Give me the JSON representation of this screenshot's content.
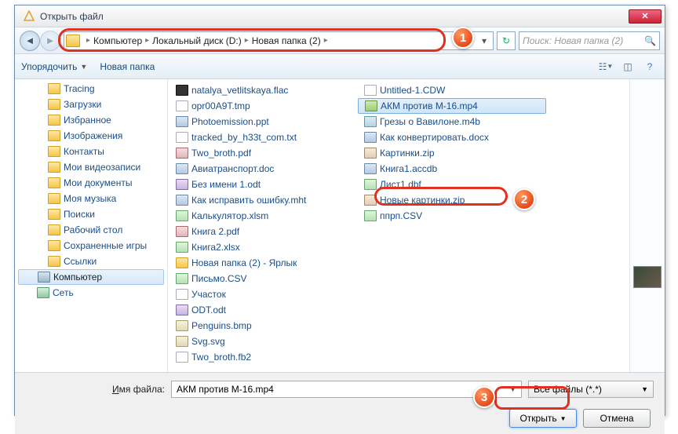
{
  "title": "Открыть файл",
  "breadcrumb": [
    "Компьютер",
    "Локальный диск (D:)",
    "Новая папка (2)"
  ],
  "search_placeholder": "Поиск: Новая папка (2)",
  "toolbar": {
    "organize": "Упорядочить",
    "newfolder": "Новая папка"
  },
  "tree": [
    {
      "label": "Tracing",
      "ico": "folder",
      "lvl": 1
    },
    {
      "label": "Загрузки",
      "ico": "folder",
      "lvl": 1
    },
    {
      "label": "Избранное",
      "ico": "folder",
      "lvl": 1
    },
    {
      "label": "Изображения",
      "ico": "folder",
      "lvl": 1
    },
    {
      "label": "Контакты",
      "ico": "folder",
      "lvl": 1
    },
    {
      "label": "Мои видеозаписи",
      "ico": "folder",
      "lvl": 1
    },
    {
      "label": "Мои документы",
      "ico": "folder",
      "lvl": 1
    },
    {
      "label": "Моя музыка",
      "ico": "folder",
      "lvl": 1
    },
    {
      "label": "Поиски",
      "ico": "folder",
      "lvl": 1
    },
    {
      "label": "Рабочий стол",
      "ico": "folder",
      "lvl": 1
    },
    {
      "label": "Сохраненные игры",
      "ico": "folder",
      "lvl": 1
    },
    {
      "label": "Ссылки",
      "ico": "folder",
      "lvl": 1
    },
    {
      "label": "Компьютер",
      "ico": "comp",
      "lvl": 0,
      "sel": true
    },
    {
      "label": "Сеть",
      "ico": "net",
      "lvl": 0
    }
  ],
  "files_col1": [
    {
      "name": "natalya_vetlitskaya.flac",
      "ico": "flac"
    },
    {
      "name": "opr00A9T.tmp",
      "ico": "txt"
    },
    {
      "name": "Photoemission.ppt",
      "ico": "doc"
    },
    {
      "name": "tracked_by_h33t_com.txt",
      "ico": "txt"
    },
    {
      "name": "Two_broth.pdf",
      "ico": "pdf"
    },
    {
      "name": "Авиатранспорт.doc",
      "ico": "doc"
    },
    {
      "name": "Без имени 1.odt",
      "ico": "odt"
    },
    {
      "name": "Как исправить ошибку.mht",
      "ico": "doc"
    },
    {
      "name": "Калькулятор.xlsm",
      "ico": "xls"
    },
    {
      "name": "Книга 2.pdf",
      "ico": "pdf"
    },
    {
      "name": "Книга2.xlsx",
      "ico": "xls"
    },
    {
      "name": "Новая папка (2) - Ярлык",
      "ico": "folder"
    },
    {
      "name": "Письмо.CSV",
      "ico": "xls"
    },
    {
      "name": "Участок",
      "ico": "txt"
    }
  ],
  "files_col2": [
    {
      "name": "ODT.odt",
      "ico": "odt"
    },
    {
      "name": "Penguins.bmp",
      "ico": "img"
    },
    {
      "name": "Svg.svg",
      "ico": "img"
    },
    {
      "name": "Two_broth.fb2",
      "ico": "txt"
    },
    {
      "name": "Untitled-1.CDW",
      "ico": "txt"
    },
    {
      "name": "АКМ против М-16.mp4",
      "ico": "mp4g",
      "sel": true
    },
    {
      "name": "Грезы о Вавилоне.m4b",
      "ico": "vid"
    },
    {
      "name": "Как конвертировать.docx",
      "ico": "doc"
    },
    {
      "name": "Картинки.zip",
      "ico": "zip"
    },
    {
      "name": "Книга1.accdb",
      "ico": "doc"
    },
    {
      "name": "Лист1.dbf",
      "ico": "xls"
    },
    {
      "name": "Новые картинки.zip",
      "ico": "zip"
    },
    {
      "name": "ппрп.CSV",
      "ico": "xls"
    }
  ],
  "filename_label_pre": "",
  "filename_label_u": "И",
  "filename_label_post": "мя файла:",
  "filename_value": "АКМ против М-16.mp4",
  "filter_value": "Все файлы (*.*)",
  "btn_open": "Открыть",
  "btn_cancel": "Отмена",
  "badges": {
    "b1": "1",
    "b2": "2",
    "b3": "3"
  }
}
